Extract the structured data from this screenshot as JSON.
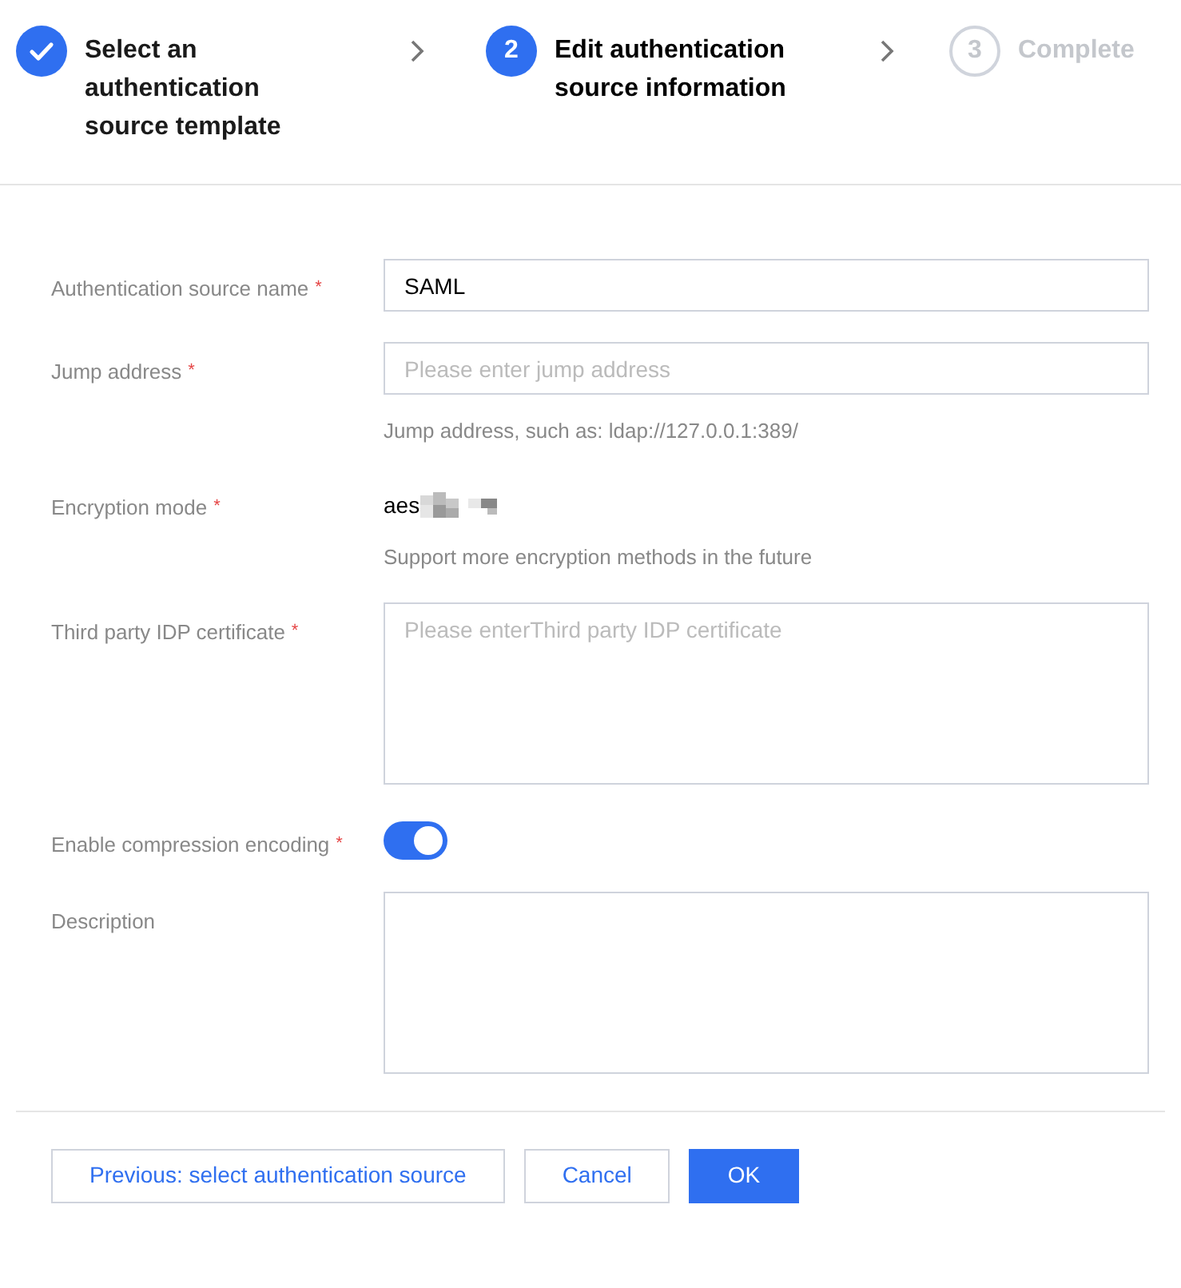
{
  "steps": [
    {
      "completed": true,
      "selected": false,
      "label": "Select an authentication source template"
    },
    {
      "completed": false,
      "selected": true,
      "number": "2",
      "label": "Edit authentication source information"
    },
    {
      "completed": false,
      "selected": false,
      "number": "3",
      "label": "Complete"
    }
  ],
  "form": [
    {
      "kind": "input",
      "label": "Authentication source name",
      "required_mark": "*",
      "value": "SAML"
    },
    {
      "kind": "input",
      "label": "Jump address",
      "required_mark": "*",
      "placeholder": "Please enter jump address",
      "help": "Jump address, such as: ldap://127.0.0.1:389/"
    },
    {
      "kind": "text",
      "label": "Encryption mode",
      "required_mark": "*",
      "value": "aes",
      "help": "Support more encryption methods in the future"
    },
    {
      "kind": "textarea",
      "label": "Third party IDP certificate",
      "required_mark": "*",
      "placeholder": "Please enterThird party IDP certificate"
    },
    {
      "kind": "switch",
      "label": "Enable compression encoding",
      "required_mark": "*",
      "on": true
    },
    {
      "kind": "textarea",
      "label": "Description"
    }
  ],
  "buttons": [
    {
      "kind": "secondary",
      "label": "Previous: select authentication source"
    },
    {
      "kind": "secondary",
      "label": "Cancel"
    },
    {
      "kind": "primary",
      "label": "OK"
    }
  ]
}
